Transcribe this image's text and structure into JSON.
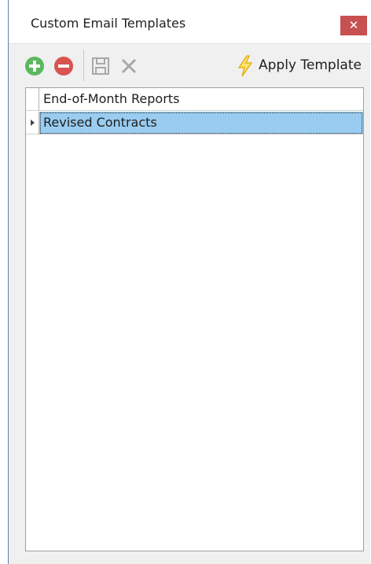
{
  "window": {
    "title": "Custom Email Templates",
    "close_glyph": "✕"
  },
  "toolbar": {
    "add_icon": "plus-circle-icon",
    "remove_icon": "minus-circle-icon",
    "save_icon": "floppy-disk-icon",
    "cancel_icon": "x-icon",
    "apply_icon": "lightning-bolt-icon",
    "apply_label": "Apply Template"
  },
  "templates": {
    "rows": [
      {
        "name": "End-of-Month Reports",
        "selected": false
      },
      {
        "name": "Revised Contracts",
        "selected": true
      }
    ]
  },
  "colors": {
    "add_green": "#5cb85c",
    "remove_red": "#d9534f",
    "close_red": "#c75050",
    "selection_blue": "#99ccf0",
    "bolt_yellow": "#f5c518"
  }
}
